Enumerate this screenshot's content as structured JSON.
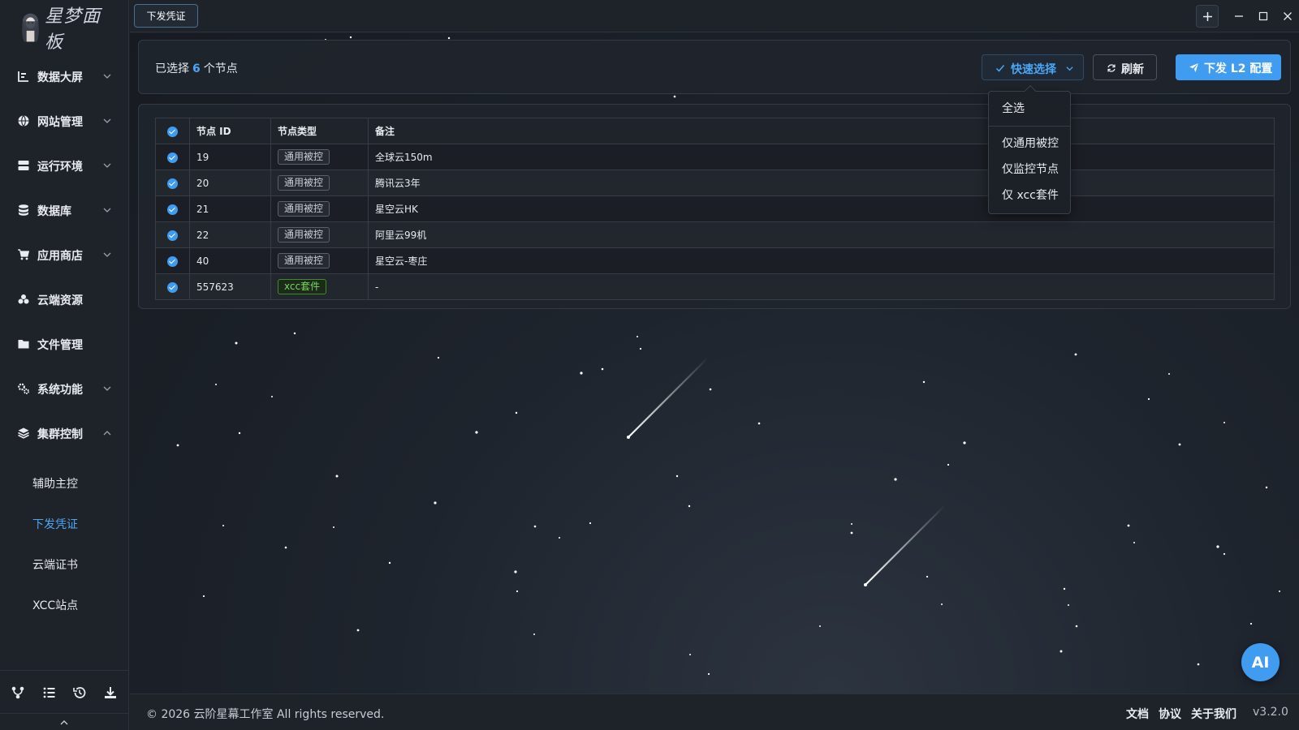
{
  "app": {
    "logo_text": "星梦面板",
    "accent_color": "#3f9cf1"
  },
  "sidebar": {
    "items": [
      {
        "label": "数据大屏",
        "icon": "bar-chart-icon",
        "expandable": true
      },
      {
        "label": "网站管理",
        "icon": "globe-icon",
        "expandable": true
      },
      {
        "label": "运行环境",
        "icon": "server-icon",
        "expandable": true
      },
      {
        "label": "数据库",
        "icon": "database-icon",
        "expandable": true
      },
      {
        "label": "应用商店",
        "icon": "cart-icon",
        "expandable": true
      },
      {
        "label": "云端资源",
        "icon": "cloud-icon",
        "expandable": false
      },
      {
        "label": "文件管理",
        "icon": "folder-icon",
        "expandable": false
      },
      {
        "label": "系统功能",
        "icon": "gears-icon",
        "expandable": true
      },
      {
        "label": "集群控制",
        "icon": "layers-icon",
        "expandable": true,
        "expanded": true
      }
    ],
    "subitems": [
      {
        "label": "辅助主控",
        "active": false
      },
      {
        "label": "下发凭证",
        "active": true
      },
      {
        "label": "云端证书",
        "active": false
      },
      {
        "label": "XCC站点",
        "active": false
      }
    ],
    "bottom_tools": [
      "branch-icon",
      "list-icon",
      "history-icon",
      "download-icon"
    ]
  },
  "topbar": {
    "active_tab": "下发凭证"
  },
  "header": {
    "selected_prefix": "已选择",
    "selected_count": "6",
    "selected_suffix": "个节点",
    "quick_select_label": "快速选择",
    "refresh_label": "刷新",
    "push_label": "下发 L2 配置"
  },
  "quick_menu": {
    "items": [
      "全选",
      "仅通用被控",
      "仅监控节点",
      "仅 xcc套件"
    ]
  },
  "table": {
    "columns": [
      "节点 ID",
      "节点类型",
      "备注"
    ],
    "rows": [
      {
        "id": "19",
        "type": "通用被控",
        "remark": "全球云150m"
      },
      {
        "id": "20",
        "type": "通用被控",
        "remark": "腾讯云3年"
      },
      {
        "id": "21",
        "type": "通用被控",
        "remark": "星空云HK"
      },
      {
        "id": "22",
        "type": "通用被控",
        "remark": "阿里云99机"
      },
      {
        "id": "40",
        "type": "通用被控",
        "remark": "星空云-枣庄"
      },
      {
        "id": "557623",
        "type": "xcc套件",
        "remark": "-"
      }
    ]
  },
  "footer": {
    "copyright": "© 2026 云阶星幕工作室 All rights reserved.",
    "links": [
      "文档",
      "协议",
      "关于我们"
    ],
    "version": "v3.2.0"
  },
  "ai_button_label": "AI"
}
